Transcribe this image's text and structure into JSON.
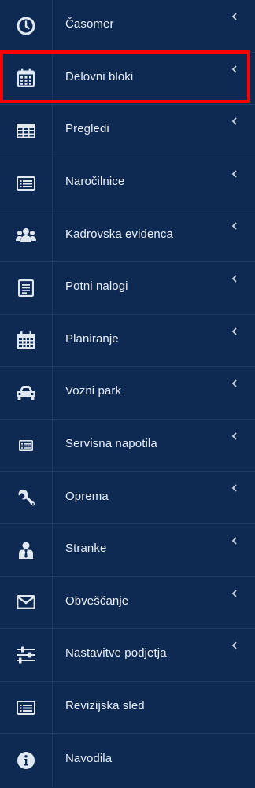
{
  "sidebar": {
    "items": [
      {
        "label": "Časomer",
        "icon": "clock-icon",
        "has_submenu": true
      },
      {
        "label": "Delovni bloki",
        "icon": "calendar-icon",
        "has_submenu": true,
        "selected": true
      },
      {
        "label": "Pregledi",
        "icon": "table-icon",
        "has_submenu": true
      },
      {
        "label": "Naročilnice",
        "icon": "list-icon",
        "has_submenu": true
      },
      {
        "label": "Kadrovska evidenca",
        "icon": "users-icon",
        "has_submenu": true
      },
      {
        "label": "Potni nalogi",
        "icon": "document-icon",
        "has_submenu": true
      },
      {
        "label": "Planiranje",
        "icon": "calendar-grid-icon",
        "has_submenu": true
      },
      {
        "label": "Vozni park",
        "icon": "car-icon",
        "has_submenu": true
      },
      {
        "label": "Servisna napotila",
        "icon": "list-small-icon",
        "has_submenu": true
      },
      {
        "label": "Oprema",
        "icon": "wrench-icon",
        "has_submenu": true
      },
      {
        "label": "Stranke",
        "icon": "person-tie-icon",
        "has_submenu": true
      },
      {
        "label": "Obveščanje",
        "icon": "envelope-icon",
        "has_submenu": true
      },
      {
        "label": "Nastavitve podjetja",
        "icon": "sliders-icon",
        "has_submenu": true
      },
      {
        "label": "Revizijska sled",
        "icon": "list-icon",
        "has_submenu": false
      },
      {
        "label": "Navodila",
        "icon": "info-icon",
        "has_submenu": false
      }
    ]
  },
  "colors": {
    "background": "#0e2a52",
    "divider": "#1c3a66",
    "text": "#e8eef7",
    "icon": "#dfe7f1",
    "highlight": "#ff0000"
  }
}
